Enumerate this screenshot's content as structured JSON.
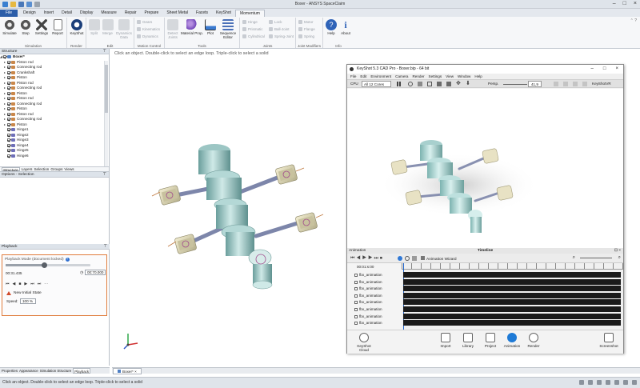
{
  "window": {
    "title": "Boxer - ANSYS SpaceClaim"
  },
  "ribbon": {
    "tabs": [
      "File",
      "Design",
      "Insert",
      "Detail",
      "Display",
      "Measure",
      "Repair",
      "Prepare",
      "Sheet Metal",
      "Facets",
      "KeyShot",
      "Momentum"
    ],
    "active_tab": "Momentum",
    "groups": {
      "simulation": {
        "label": "Simulation",
        "buttons": [
          "Simulate",
          "Step",
          "Settings",
          "Report"
        ]
      },
      "render": {
        "label": "Render",
        "buttons": [
          "KeyShot"
        ]
      },
      "edit": {
        "label": "Edit",
        "buttons": [
          "Split",
          "Merge",
          "Dynamics Data"
        ]
      },
      "motion_control": {
        "label": "Motion Control",
        "items": [
          "Gears",
          "Kinematics",
          "Dynamics"
        ]
      },
      "tools": {
        "label": "Tools",
        "buttons": [
          "Detect Joints",
          "Material Prop.",
          "Plot",
          "Sequence Editor"
        ]
      },
      "joints": {
        "label": "Joints",
        "items": [
          "Hinge",
          "Prismatic",
          "Cylindrical",
          "Lock",
          "Ball-Joint",
          "Spring-Joint"
        ]
      },
      "joint_modifiers": {
        "label": "Joint Modifiers",
        "items": [
          "Motor",
          "Flange",
          "Spring"
        ]
      },
      "info": {
        "label": "Info",
        "buttons": [
          "Help",
          "About"
        ]
      }
    }
  },
  "viewport": {
    "hint": "Click an object. Double-click to select an edge loop. Triple-click to select a solid"
  },
  "structure": {
    "header": "Structure",
    "root": "Boxer*",
    "items": [
      "Piston rod",
      "Connecting rod",
      "Crankshaft",
      "Piston",
      "Piston rod",
      "Connecting rod",
      "Piston",
      "Piston rod",
      "Connecting rod",
      "Piston",
      "Piston rod",
      "Connecting rod",
      "Piston",
      "Hinge1",
      "Hinge2",
      "Hinge3",
      "Hinge4",
      "Hinge5",
      "Hinge6"
    ],
    "item_types": [
      "comp",
      "comp",
      "comp",
      "comp",
      "comp",
      "comp",
      "comp",
      "comp",
      "comp",
      "comp",
      "comp",
      "comp",
      "comp",
      "joint",
      "joint",
      "joint",
      "joint",
      "joint",
      "joint"
    ],
    "tabs": [
      "Structure",
      "Layers",
      "Selection",
      "Groups",
      "Views"
    ]
  },
  "options": {
    "header": "Options - Selection"
  },
  "playback": {
    "header": "Playback",
    "mode_label": "Playback Mode (document locked)",
    "current_time": "00:31.435",
    "end_time": "00:70.000",
    "progress": 0.45,
    "controls": [
      "⏮",
      "◀",
      "■",
      "▶",
      "⏭",
      "⏭",
      "⋯"
    ],
    "initial_state": "New Initial State",
    "speed_label": "Speed:",
    "speed_value": "100 %"
  },
  "bottom_tabs": [
    "Properties",
    "Appearance",
    "Simulation Structure",
    "Playback"
  ],
  "doc_tab": "Boxer* ×",
  "status": {
    "text": "Click an object. Double-click to select an edge loop. Triple-click to select a solid"
  },
  "keyshot": {
    "title": "KeyShot 5.3 CAD Pro - Boxer.bip - 64 bit",
    "menu": [
      "File",
      "Edit",
      "Environment",
      "Camera",
      "Render",
      "Settings",
      "View",
      "Window",
      "Help"
    ],
    "cpu_label": "CPU",
    "cpu_value": "All 12 Cores",
    "persp_label": "Persp.",
    "persp_value": "41,9",
    "vr_label": "KeyShotVR",
    "animation_label": "Animation",
    "timeline_label": "Timeline",
    "wizard_label": "Animation Wizard",
    "timecode": "00:01:s:00",
    "tracks": [
      "fbx_animation",
      "fbx_animation",
      "fbx_animation",
      "fbx_animation",
      "fbx_animation",
      "fbx_animation",
      "fbx_animation",
      "fbx_animation"
    ],
    "footer_buttons": [
      "Import",
      "Library",
      "Project",
      "Animation",
      "Render"
    ],
    "cloud_label": "KeyShot Cloud",
    "screenshot_label": "Screenshot"
  }
}
